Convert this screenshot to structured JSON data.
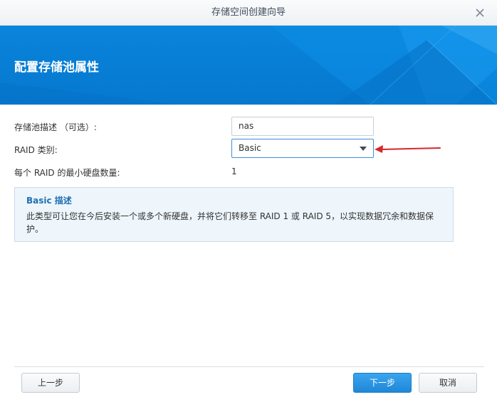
{
  "window": {
    "title": "存储空间创建向导"
  },
  "banner": {
    "heading": "配置存储池属性"
  },
  "form": {
    "description_label": "存储池描述 （可选）:",
    "description_value": "nas",
    "raid_label": "RAID 类别:",
    "raid_value": "Basic",
    "min_disks_label": "每个 RAID 的最小硬盘数量:",
    "min_disks_value": "1"
  },
  "info": {
    "title": "Basic 描述",
    "text": "此类型可让您在今后安装一个或多个新硬盘，并将它们转移至 RAID 1 或 RAID 5，以实现数据冗余和数据保护。"
  },
  "footer": {
    "back_label": "上一步",
    "next_label": "下一步",
    "cancel_label": "取消"
  },
  "icons": {
    "close": "close-icon",
    "dropdown": "chevron-down-icon",
    "annotation": "red-arrow-annotation"
  },
  "colors": {
    "banner": "#0a84db",
    "primary_button": "#2591e0",
    "annotation_arrow": "#d7262c"
  }
}
